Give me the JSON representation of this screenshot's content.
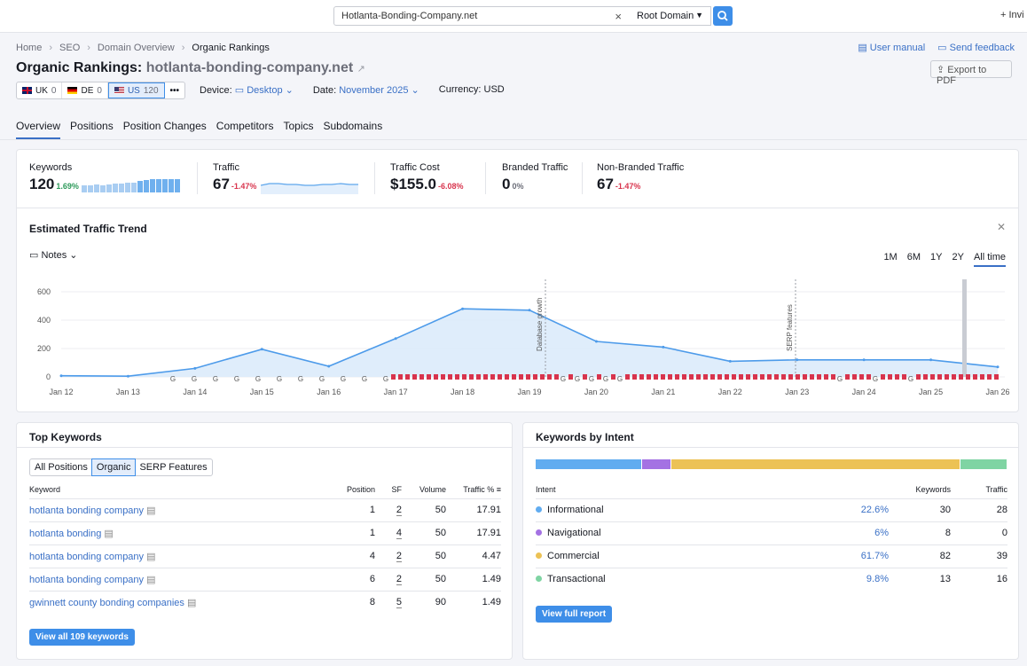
{
  "search": {
    "value": "Hotlanta-Bonding-Company.net",
    "scope": "Root Domain",
    "invite": "+ Invi"
  },
  "breadcrumb": [
    "Home",
    "SEO",
    "Domain Overview",
    "Organic Rankings"
  ],
  "header": {
    "title_prefix": "Organic Rankings:",
    "domain": "hotlanta-bonding-company.net",
    "user_manual": "User manual",
    "feedback": "Send feedback",
    "export": "Export to PDF"
  },
  "databases": [
    {
      "code": "UK",
      "count": "0"
    },
    {
      "code": "DE",
      "count": "0"
    },
    {
      "code": "US",
      "count": "120"
    }
  ],
  "filters": {
    "device_label": "Device:",
    "device": "Desktop",
    "date_label": "Date:",
    "date": "November 2025",
    "currency": "Currency: USD"
  },
  "tabs": [
    "Overview",
    "Positions",
    "Position Changes",
    "Competitors",
    "Topics",
    "Subdomains"
  ],
  "metrics": [
    {
      "label": "Keywords",
      "value": "120",
      "change": "1.69%"
    },
    {
      "label": "Traffic",
      "value": "67",
      "change": "-1.47%"
    },
    {
      "label": "Traffic Cost",
      "value": "$155.0",
      "change": "-6.08%"
    },
    {
      "label": "Branded Traffic",
      "value": "0",
      "change": "0%"
    },
    {
      "label": "Non-Branded Traffic",
      "value": "67",
      "change": "-1.47%"
    }
  ],
  "trend": {
    "title": "Estimated Traffic Trend",
    "notes": "Notes",
    "ranges": [
      "1M",
      "6M",
      "1Y",
      "2Y",
      "All time"
    ],
    "annotations": [
      "Database growth",
      "SERP features"
    ]
  },
  "chart_data": {
    "type": "area",
    "x": [
      "Jan 12",
      "Jan 13",
      "Jan 14",
      "Jan 15",
      "Jan 16",
      "Jan 17",
      "Jan 18",
      "Jan 19",
      "Jan 20",
      "Jan 21",
      "Jan 22",
      "Jan 23",
      "Jan 24",
      "Jan 25",
      "Jan 26"
    ],
    "yticks": [
      0,
      200,
      400,
      600
    ],
    "ylim": [
      0,
      650
    ],
    "series": [
      {
        "values": [
          8,
          5,
          60,
          195,
          75,
          270,
          480,
          470,
          250,
          210,
          110,
          120,
          120,
          120,
          70
        ]
      }
    ]
  },
  "top_keywords": {
    "title": "Top Keywords",
    "segments": [
      "All Positions",
      "Organic",
      "SERP Features"
    ],
    "columns": [
      "Keyword",
      "Position",
      "SF",
      "Volume",
      "Traffic %"
    ],
    "rows": [
      {
        "keyword": "hotlanta bonding company",
        "position": "1",
        "sf": "2",
        "volume": "50",
        "traffic": "17.91"
      },
      {
        "keyword": "hotlanta bonding",
        "position": "1",
        "sf": "4",
        "volume": "50",
        "traffic": "17.91"
      },
      {
        "keyword": "hotlanta bonding company",
        "position": "4",
        "sf": "2",
        "volume": "50",
        "traffic": "4.47"
      },
      {
        "keyword": "hotlanta bonding company",
        "position": "6",
        "sf": "2",
        "volume": "50",
        "traffic": "1.49"
      },
      {
        "keyword": "gwinnett county bonding companies",
        "position": "8",
        "sf": "5",
        "volume": "90",
        "traffic": "1.49"
      }
    ],
    "view_all": "View all 109 keywords"
  },
  "intent": {
    "title": "Keywords by Intent",
    "columns": [
      "Intent",
      "Keywords",
      "Traffic"
    ],
    "rows": [
      {
        "name": "Informational",
        "pct": "22.6%",
        "pct_value": 22.6,
        "keywords": "30",
        "traffic": "28",
        "color": "#61acf0"
      },
      {
        "name": "Navigational",
        "pct": "6%",
        "pct_value": 6,
        "keywords": "8",
        "traffic": "0",
        "color": "#a472e3"
      },
      {
        "name": "Commercial",
        "pct": "61.7%",
        "pct_value": 61.7,
        "keywords": "82",
        "traffic": "39",
        "color": "#ecc255"
      },
      {
        "name": "Transactional",
        "pct": "9.8%",
        "pct_value": 9.8,
        "keywords": "13",
        "traffic": "16",
        "color": "#7fd4a3"
      }
    ],
    "view_full": "View full report"
  }
}
